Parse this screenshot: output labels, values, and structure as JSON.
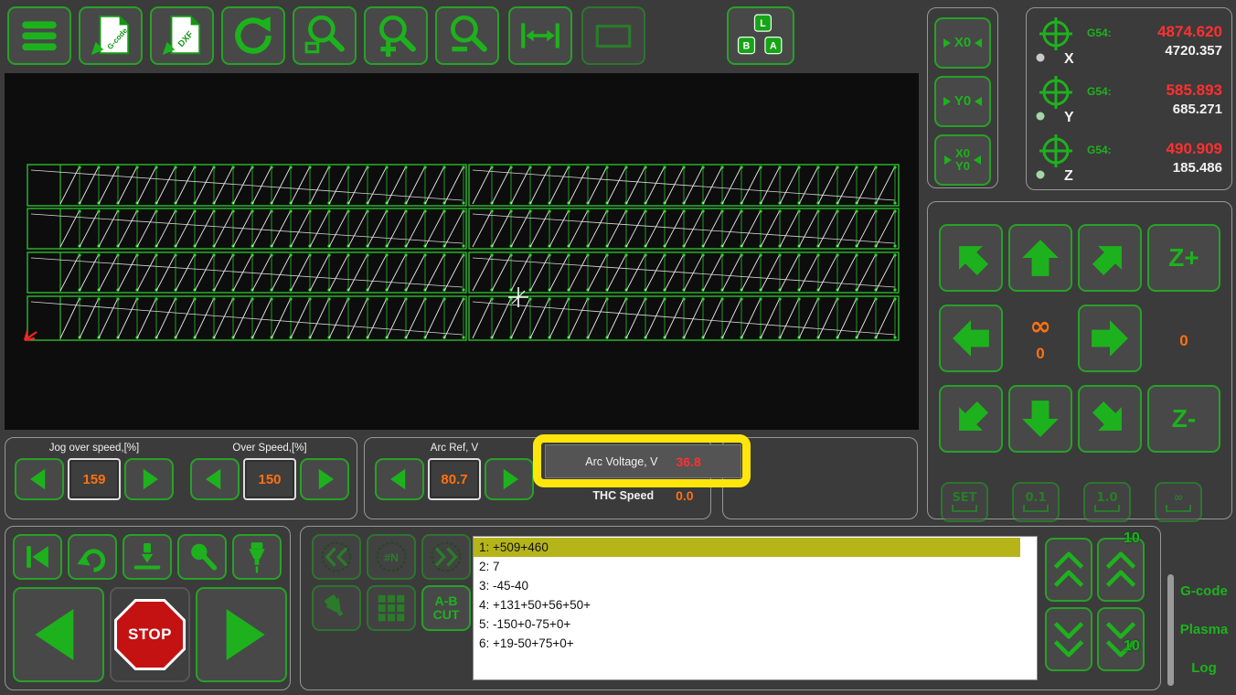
{
  "colors": {
    "background": "#3b3b3b",
    "accent_green": "#1db21d",
    "value_orange": "#ff7010",
    "alert_red": "#ff3030",
    "highlight_yellow": "#ffe60a",
    "active_line_bg": "#b5b51a",
    "canvas_black": "#0d0d0d"
  },
  "toolbar": {
    "gcode_icon_text": "G-code",
    "dxf_icon_text": "DXF",
    "key_l": "L",
    "key_b": "B",
    "key_a": "A"
  },
  "zero_panel": {
    "x0_label": "X0",
    "y0_label": "Y0",
    "x0y0_top": "X0",
    "x0y0_bottom": "Y0"
  },
  "dro": {
    "axes": [
      {
        "axis": "X",
        "offset_label": "G54:",
        "offset_value": "4874.620",
        "machine_value": "4720.357",
        "led": "#c9c9c9"
      },
      {
        "axis": "Y",
        "offset_label": "G54:",
        "offset_value": "585.893",
        "machine_value": "685.271",
        "led": "#a5d6a5"
      },
      {
        "axis": "Z",
        "offset_label": "G54:",
        "offset_value": "490.909",
        "machine_value": "185.486",
        "led": "#a5d6a5"
      }
    ]
  },
  "jog": {
    "z_plus_label": "Z+",
    "z_minus_label": "Z-",
    "center_symbol": "∞",
    "center_value": "0",
    "side_value": "0",
    "steps": [
      {
        "label": "SET"
      },
      {
        "label": "0.1"
      },
      {
        "label": "1.0"
      },
      {
        "label": "∞"
      }
    ]
  },
  "speed_controls": {
    "jog_over_speed": {
      "label": "Jog over speed,[%]",
      "value": "159"
    },
    "over_speed": {
      "label": "Over Speed,[%]",
      "value": "150"
    },
    "arc_ref": {
      "label": "Arc Ref, V",
      "value": "80.7"
    }
  },
  "thc": {
    "arc_voltage_label": "Arc Voltage, V",
    "arc_voltage_value": "36.8",
    "thc_speed_label": "THC Speed",
    "thc_speed_value": "0.0"
  },
  "transport": {
    "stop_label": "STOP"
  },
  "program": {
    "hash_n_label": "#N",
    "ab_cut_line1": "A-B",
    "ab_cut_line2": "CUT",
    "lines": [
      "1: +509+460",
      "2: 7",
      "3: -45-40",
      "4: +131+50+56+50+",
      "5: -150+0-75+0+",
      "6: +19-50+75+0+"
    ],
    "scroll_step_top": "10",
    "scroll_step_bottom": "10"
  },
  "tabs": [
    {
      "label": "G-code"
    },
    {
      "label": "Plasma"
    },
    {
      "label": "Log"
    }
  ]
}
